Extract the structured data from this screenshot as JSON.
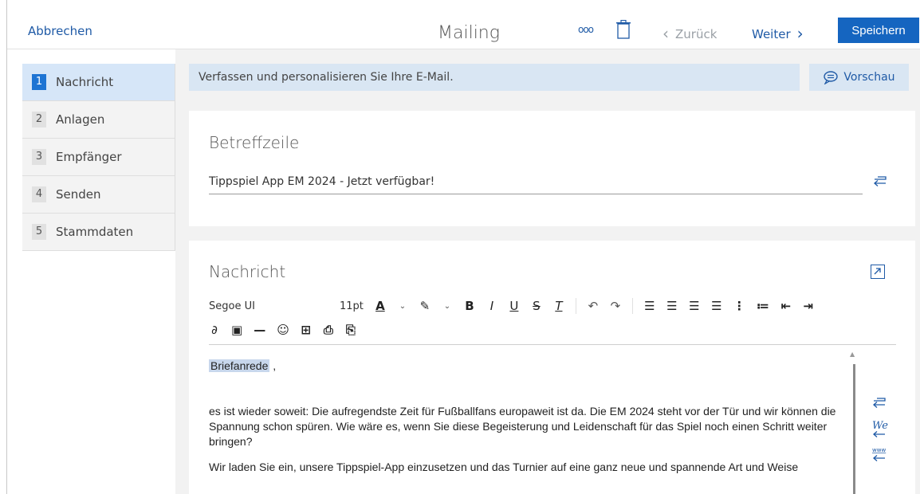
{
  "topbar": {
    "cancel_label": "Abbrechen",
    "title": "Mailing",
    "more_label": "ooo",
    "back_label": "Zurück",
    "next_label": "Weiter",
    "save_label": "Speichern"
  },
  "sidebar": {
    "items": [
      {
        "num": "1",
        "label": "Nachricht",
        "active": true
      },
      {
        "num": "2",
        "label": "Anlagen"
      },
      {
        "num": "3",
        "label": "Empfänger"
      },
      {
        "num": "4",
        "label": "Senden"
      },
      {
        "num": "5",
        "label": "Stammdaten"
      }
    ]
  },
  "info": {
    "text": "Verfassen und personalisieren Sie Ihre E-Mail.",
    "preview_label": "Vorschau"
  },
  "subject": {
    "title": "Betreffzeile",
    "value": "Tippspiel App EM 2024 - Jetzt verfügbar!"
  },
  "message": {
    "title": "Nachricht",
    "font": "Segoe UI",
    "size": "11pt",
    "salutation": "Briefanrede",
    "salutation_suffix": " ,",
    "paragraph1": "es ist wieder soweit: Die aufregendste Zeit für Fußballfans europaweit ist da. Die EM 2024 steht vor der Tür und wir können die Spannung schon spüren. Wie wäre es, wenn Sie diese Begeisterung und Leidenschaft für das Spiel noch einen Schritt weiter bringen?",
    "paragraph2": "Wir laden Sie ein, unsere Tippspiel-App einzusetzen und das Turnier auf eine ganz neue und spannende Art und Weise"
  },
  "colors": {
    "accent": "#1565c0",
    "link": "#1f5aa6",
    "sidebar_active": "#d6e6f8",
    "info_bar": "#d9e6f3"
  }
}
